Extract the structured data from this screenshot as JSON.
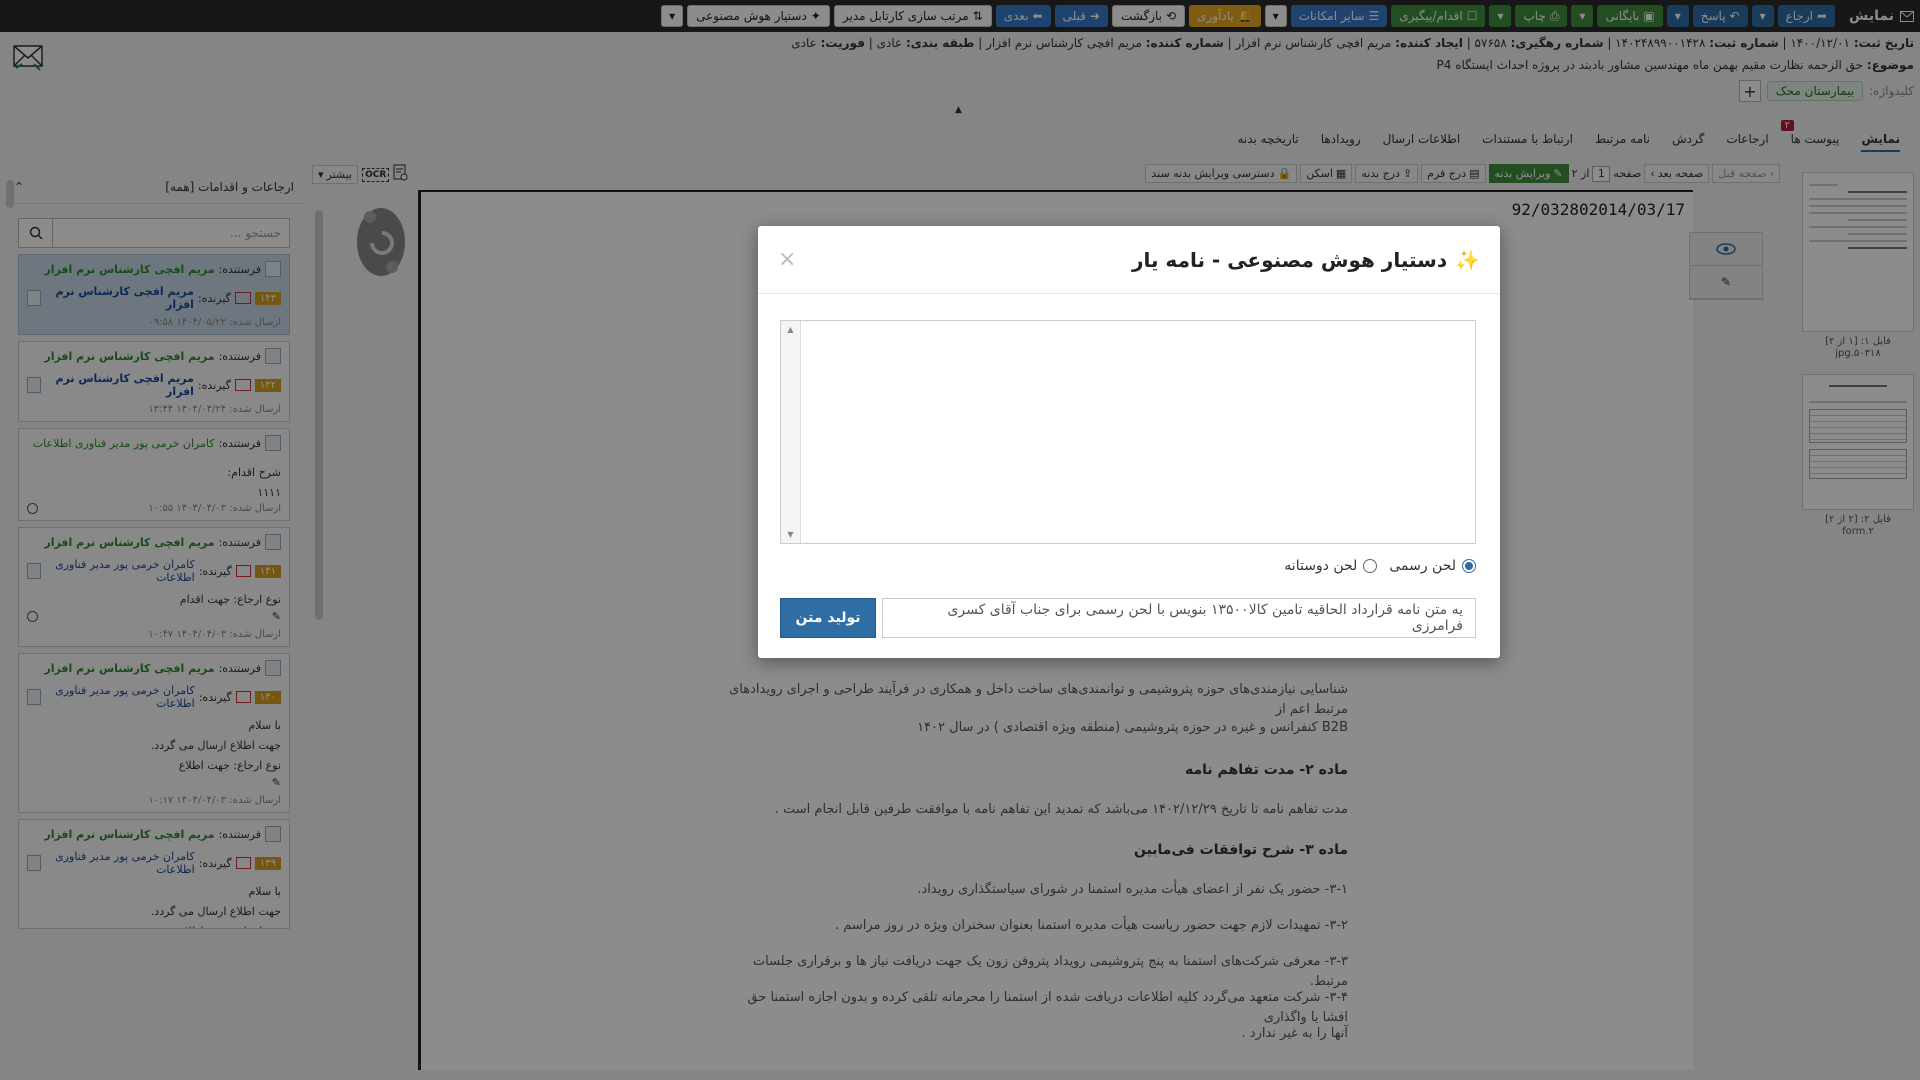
{
  "topbar": {
    "brand": "نمایش",
    "buttons": [
      {
        "label": "ارجاع",
        "style": "blue"
      },
      {
        "label": "پاسخ",
        "style": "blue"
      },
      {
        "label": "بایگانی",
        "style": "green"
      },
      {
        "label": "چاپ",
        "style": "green"
      },
      {
        "label": "اقدام/پیگیری",
        "style": "green"
      },
      {
        "label": "سایر امکانات",
        "style": "blue-l"
      },
      {
        "label": "یادآوری",
        "style": "yellow"
      },
      {
        "label": "بازگشت",
        "style": "white"
      },
      {
        "label": "قبلی",
        "style": "blue-l"
      },
      {
        "label": "بعدی",
        "style": "blue-l"
      },
      {
        "label": "مرتب سازی کارتابل مدیر",
        "style": "white"
      },
      {
        "label": "دستیار هوش مصنوعی",
        "style": "white"
      }
    ]
  },
  "meta": {
    "reg_date_label": "تاریخ ثبت:",
    "reg_date": "۱۴۰۰/۱۲/۰۱",
    "reg_no_label": "شماره ثبت:",
    "reg_no": "۱۴۰۲۴۸۹۹۰۰۱۴۲۸",
    "track_no_label": "شماره رهگیری:",
    "track_no": "۵۷۶۵۸",
    "creator_label": "ایجاد کننده:",
    "creator": "مریم افچی کارشناس نرم افزار",
    "creator_no_label": "شماره کننده:",
    "creator_no": "مریم افچی کارشناس نرم افزار",
    "class_label": "طبقه بندی:",
    "class_value": "عادی",
    "urgency_label": "فوریت:",
    "urgency_value": "عادی",
    "subject_label": "موضوع:",
    "subject": "حق الزحمه نظارت مقیم بهمن ماه مهندسین مشاور بادبند در پروژه احداث ایستگاه P4"
  },
  "keywords": {
    "label": "کلیدواژه:",
    "chip": "بیمارستان محک"
  },
  "tabs": [
    {
      "label": "نمایش",
      "active": true
    },
    {
      "label": "پیوست ها",
      "badge": "۲"
    },
    {
      "label": "ارجاعات"
    },
    {
      "label": "گردش"
    },
    {
      "label": "نامه مرتبط"
    },
    {
      "label": "ارتباط با مستندات"
    },
    {
      "label": "اطلاعات ارسال"
    },
    {
      "label": "رویدادها"
    },
    {
      "label": "تاریخچه بدنه"
    }
  ],
  "doc_toolbar": {
    "prev_page": "صفحه قبل",
    "next_page": "صفحه بعد",
    "page_label": "صفحه",
    "page_value": "1",
    "of_label": "از ۲",
    "edit_body": "ویرایش بدنه",
    "insert_form": "درج فرم",
    "insert_body": "درج بدنه",
    "scan": "اسکن",
    "access": "دسترسی ویرایش بدنه سند"
  },
  "left_tools": {
    "more": "بیشتر"
  },
  "thumbs": [
    {
      "caption1": "فایل ۱: [۱ از ۲]",
      "caption2": "jpg.۵۰۳۱۸"
    },
    {
      "caption1": "فایل ۲: [۲ از ۲]",
      "caption2": "form.۲"
    }
  ],
  "document": {
    "number": "92/032802014/03/17",
    "para1": "شناسایی نیازمندی‌های حوزه پتروشیمی و توانمندی‌های ساخت داخل و همکاری در فرآیند طراحی و اجرای رویدادهای مرتبط اعم از",
    "para1b": "B2B کنفرانس و غیره در حوزه پتروشیمی (منطقه ویژه اقتصادی ) در سال ۱۴۰۲",
    "h2": "ماده ۲- مدت تفاهم نامه",
    "para2": "مدت تفاهم نامه تا تاریخ ۱۴۰۲/۱۲/۲۹ می‌باشد که تمدید این تفاهم نامه با موافقت طرفین قابل انجام است .",
    "h3": "ماده ۳- شرح توافقات فی‌مابین",
    "item1": "۳-۱- حضور یک نفر از اعضای هیأت مدیره استمنا در شورای سیاستگذاری رویداد.",
    "item2": "۳-۲- تمهیدات لازم جهت حضور ریاست هیأت مدیره استمنا بعنوان سخنران ویژه در روز مراسم .",
    "item3": "۳-۳- معرفی شرکت‌های استمنا به پنج پتروشیمی رویداد پتروفن زون یک جهت دریافت نیاز ها و برقراری جلسات مرتبط.",
    "item4": "۳-۴- شرکت متعهد می‌گردد کلیه اطلاعات دریافت شده از استمنا را محرمانه تلقی کرده و بدون اجازه استمنا حق افشا یا واگذاری",
    "item4b": "آنها را به غیر ندارد ."
  },
  "sidebar": {
    "title": "ارجاعات و اقدامات [همه]",
    "search_placeholder": "جستجو ...",
    "sender_label": "فرستنده:",
    "receiver_label": "گیرنده:",
    "sent_label": "ارسال شده:",
    "cards": [
      {
        "sender": "مریم افچی کارشناس نرم افزار",
        "receiver": "مریم افچی کارشناس نرم افزار",
        "num": "۱۴۳",
        "date": "۱۴۰۴/۰۵/۲۲ ۰۹:۵۸",
        "active": true
      },
      {
        "sender": "مریم افچی کارشناس نرم افزار",
        "receiver": "مریم افچی کارشناس نرم افزار",
        "num": "۱۴۲",
        "date": "۱۴۰۴/۰۴/۲۴ ۱۳:۴۴"
      },
      {
        "sender": "کامران خرمی پور مدیر فناوری اطلاعات",
        "action_label": "شرح اقدام:",
        "action": "۱۱۱۱",
        "date": "۱۴۰۴/۰۴/۰۳ ۱۰:۵۵"
      },
      {
        "sender": "مریم افچی کارشناس نرم افزار",
        "receiver": "کامران خرمی پور مدیر فناوری اطلاعات",
        "num": "۱۴۱",
        "type": "نوع ارجاع: جهت اقدام",
        "date": "۱۴۰۴/۰۴/۰۳ ۱۰:۴۷"
      },
      {
        "sender": "مریم افچی کارشناس نرم افزار",
        "receiver": "کامران خرمی پور مدیر فناوری اطلاعات",
        "num": "۱۴۰",
        "msg1": "با سلام",
        "msg2": "جهت اطلاع ارسال می گردد.",
        "type": "نوع ارجاع: جهت اطلاع",
        "date": "۱۴۰۴/۰۴/۰۳ ۱۰:۱۷"
      },
      {
        "sender": "مریم افچی کارشناس نرم افزار",
        "receiver": "کامران خرمی پور مدیر فناوری اطلاعات",
        "num": "۱۳۹",
        "msg1": "با سلام",
        "msg2": "جهت اطلاع ارسال می گردد.",
        "type": "نوع ارجاع: جهت اطلاع"
      }
    ]
  },
  "modal": {
    "title": "دستیار هوش مصنوعی - نامه یار",
    "close": "×",
    "tone_formal": "لحن رسمی",
    "tone_friendly": "لحن دوستانه",
    "prompt": "یه متن نامه قرارداد الحاقیه تامین کالا۱۳۵۰۰ بنویس با لحن رسمی برای جناب آقای کسری فرامرزی",
    "generate": "تولید متن"
  },
  "colors": {
    "topbar": "#2b2b2b",
    "primary": "#2f6ea5",
    "green": "#3f8f3f",
    "yellow": "#e8a820",
    "badge": "#b0203a"
  }
}
